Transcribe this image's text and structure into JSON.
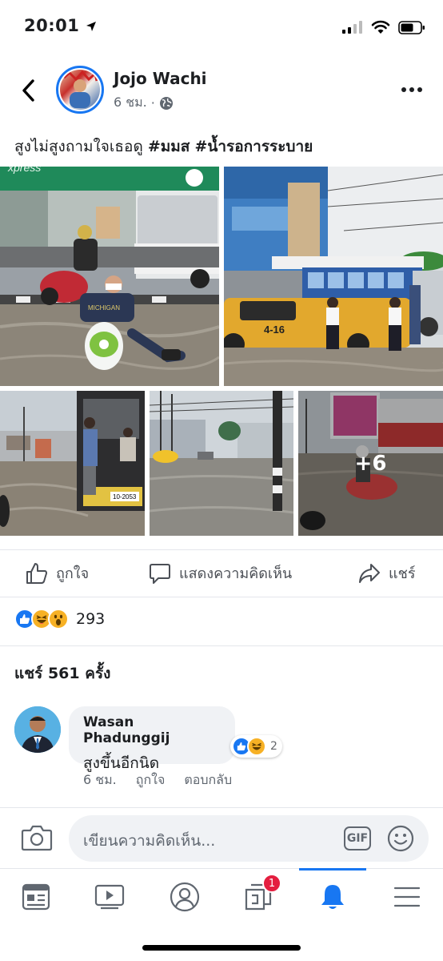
{
  "status_bar": {
    "time": "20:01"
  },
  "post": {
    "author": "Jojo Wachi",
    "time": "6 ชม.",
    "dot": "·",
    "text_plain": "สูงไม่สูงถามใจเธอดู ",
    "hashtag_1": "#มมส",
    "hashtag_2": "#น้ำรอการระบาย",
    "photos": [
      {
        "description": "flooded-street-scooter",
        "sign": "xpress",
        "scooter_text": "MICHIGAN"
      },
      {
        "description": "yellow-truck-students",
        "plate": "4-16"
      },
      {
        "description": "bus-passengers",
        "plate": "10-2053"
      },
      {
        "description": "flooded-intersection"
      },
      {
        "description": "motorbike-flood",
        "more_label": "+6"
      }
    ]
  },
  "actions": {
    "like": "ถูกใจ",
    "comment": "แสดงความคิดเห็น",
    "share": "แชร์"
  },
  "reactions": {
    "count": "293",
    "types": [
      "like",
      "haha",
      "wow"
    ]
  },
  "shares_label": "แชร์ 561 ครั้ง",
  "comment": {
    "author": "Wasan Phadunggij",
    "text": "สูงขึ้นอีกนิด",
    "reaction_count": "2",
    "time": "6 ชม.",
    "like": "ถูกใจ",
    "reply": "ตอบกลับ"
  },
  "composer": {
    "placeholder": "เขียนความคิดเห็น...",
    "gif": "GIF"
  },
  "tab_bar": {
    "items": [
      "news-feed",
      "watch",
      "profile",
      "pages",
      "notifications",
      "menu"
    ],
    "pages_badge": "1"
  },
  "colors": {
    "accent": "#1877f2",
    "badge": "#e41e3f",
    "text": "#1c1e21",
    "muted": "#606770"
  }
}
